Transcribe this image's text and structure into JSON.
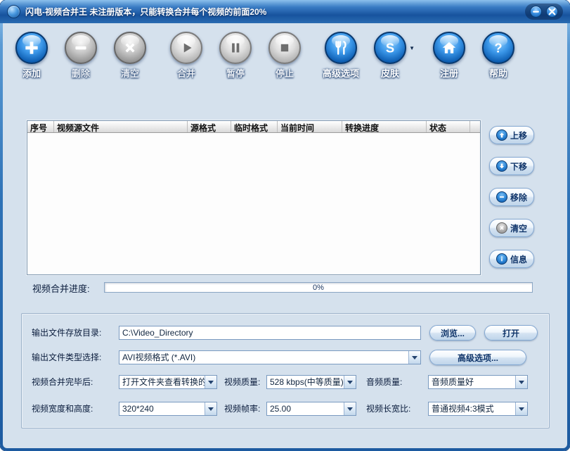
{
  "window": {
    "title": "闪电-视频合并王  未注册版本，只能转换合并每个视频的前面20%"
  },
  "toolbar": {
    "items": [
      {
        "label": "添加"
      },
      {
        "label": "删除"
      },
      {
        "label": "清空"
      },
      {
        "label": "合并"
      },
      {
        "label": "暂停"
      },
      {
        "label": "停止"
      },
      {
        "label": "高级选项"
      },
      {
        "label": "皮肤"
      },
      {
        "label": "注册"
      },
      {
        "label": "帮助"
      }
    ]
  },
  "table": {
    "columns": [
      "序号",
      "视频源文件",
      "源格式",
      "临时格式",
      "当前时间",
      "转换进度",
      "状态"
    ]
  },
  "side_buttons": [
    {
      "label": "上移"
    },
    {
      "label": "下移"
    },
    {
      "label": "移除"
    },
    {
      "label": "清空"
    },
    {
      "label": "信息"
    }
  ],
  "progress": {
    "label": "视频合并进度:",
    "value": "0%"
  },
  "settings": {
    "output_dir": {
      "label": "输出文件存放目录:",
      "value": "C:\\Video_Directory",
      "browse": "浏览...",
      "open": "打开"
    },
    "output_type": {
      "label": "输出文件类型选择:",
      "value": "AVI视频格式 (*.AVI)",
      "advanced": "高级选项..."
    },
    "after_merge": {
      "label": "视频合并完毕后:",
      "value": "打开文件夹查看转换的"
    },
    "video_quality": {
      "label": "视频质量:",
      "value": "528 kbps(中等质量)"
    },
    "audio_quality": {
      "label": "音频质量:",
      "value": "音频质量好"
    },
    "dimensions": {
      "label": "视频宽度和高度:",
      "value": "320*240"
    },
    "framerate": {
      "label": "视频帧率:",
      "value": "25.00"
    },
    "aspect": {
      "label": "视频长宽比:",
      "value": "普通视频4:3模式"
    }
  },
  "colors": {
    "accent_blue": "#0c5cb0",
    "client_bg": "#d5e1ed",
    "titlebar_blue": "#17539e"
  }
}
